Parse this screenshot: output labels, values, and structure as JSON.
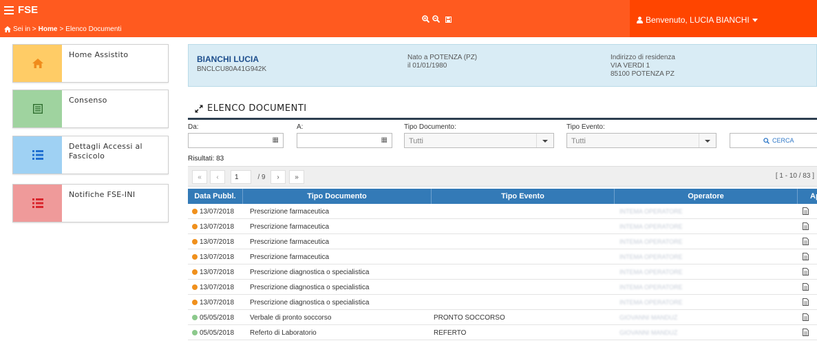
{
  "header": {
    "app_title": "FSE",
    "breadcrumb": {
      "prefix": "Sei in >",
      "home": "Home",
      "sep": ">",
      "current": "Elenco Documenti"
    },
    "user_label": "Benvenuto, LUCIA BIANCHI"
  },
  "sidebar": {
    "items": [
      {
        "label": "Home Assistito",
        "icon": "home-icon",
        "color": "#ffcc66"
      },
      {
        "label": "Consenso",
        "icon": "list-alt-icon",
        "color": "#9fd39f"
      },
      {
        "label": "Dettagli Accessi al Fascicolo",
        "icon": "list-icon",
        "color": "#9fd1f3"
      },
      {
        "label": "Notifiche FSE-INI",
        "icon": "list-icon",
        "color": "#ef9a9a"
      }
    ]
  },
  "patient": {
    "name": "BIANCHI LUCIA",
    "fiscal_code": "BNCLCU80A41G942K",
    "birth_place": "Nato a POTENZA (PZ)",
    "birth_date": "il 01/01/1980",
    "address_label": "Indirizzo di residenza",
    "address_line1": "VIA VERDI 1",
    "address_line2": "85100 POTENZA PZ"
  },
  "section": {
    "title": "ELENCO DOCUMENTI"
  },
  "filters": {
    "from_label": "Da:",
    "to_label": "A:",
    "doc_type_label": "Tipo Documento:",
    "doc_type_value": "Tutti",
    "event_type_label": "Tipo Evento:",
    "event_type_value": "Tutti",
    "search_label": "CERCA"
  },
  "results": {
    "label": "Risultati: 83"
  },
  "pager": {
    "first": "«",
    "prev": "‹",
    "page_value": "1",
    "total_pages": "/ 9",
    "next": "›",
    "last": "»",
    "range": "[ 1 - 10 / 83 ]"
  },
  "table": {
    "columns": [
      "Data Pubbl.",
      "Tipo Documento",
      "Tipo Evento",
      "Operatore",
      "Apri"
    ],
    "rows": [
      {
        "status_color": "#f0901c",
        "date": "13/07/2018",
        "doc_type": "Prescrizione farmaceutica",
        "event_type": "",
        "operator": "INTEMA OPERATORE"
      },
      {
        "status_color": "#f0901c",
        "date": "13/07/2018",
        "doc_type": "Prescrizione farmaceutica",
        "event_type": "",
        "operator": "INTEMA OPERATORE"
      },
      {
        "status_color": "#f0901c",
        "date": "13/07/2018",
        "doc_type": "Prescrizione farmaceutica",
        "event_type": "",
        "operator": "INTEMA OPERATORE"
      },
      {
        "status_color": "#f0901c",
        "date": "13/07/2018",
        "doc_type": "Prescrizione farmaceutica",
        "event_type": "",
        "operator": "INTEMA OPERATORE"
      },
      {
        "status_color": "#f0901c",
        "date": "13/07/2018",
        "doc_type": "Prescrizione diagnostica o specialistica",
        "event_type": "",
        "operator": "INTEMA OPERATORE"
      },
      {
        "status_color": "#f0901c",
        "date": "13/07/2018",
        "doc_type": "Prescrizione diagnostica o specialistica",
        "event_type": "",
        "operator": "INTEMA OPERATORE"
      },
      {
        "status_color": "#f0901c",
        "date": "13/07/2018",
        "doc_type": "Prescrizione diagnostica o specialistica",
        "event_type": "",
        "operator": "INTEMA OPERATORE"
      },
      {
        "status_color": "#8cc98c",
        "date": "05/05/2018",
        "doc_type": "Verbale di pronto soccorso",
        "event_type": "PRONTO SOCCORSO",
        "operator": "GIOVANNI MANDUZ"
      },
      {
        "status_color": "#8cc98c",
        "date": "05/05/2018",
        "doc_type": "Referto di Laboratorio",
        "event_type": "REFERTO",
        "operator": "GIOVANNI MANDUZ"
      }
    ]
  }
}
